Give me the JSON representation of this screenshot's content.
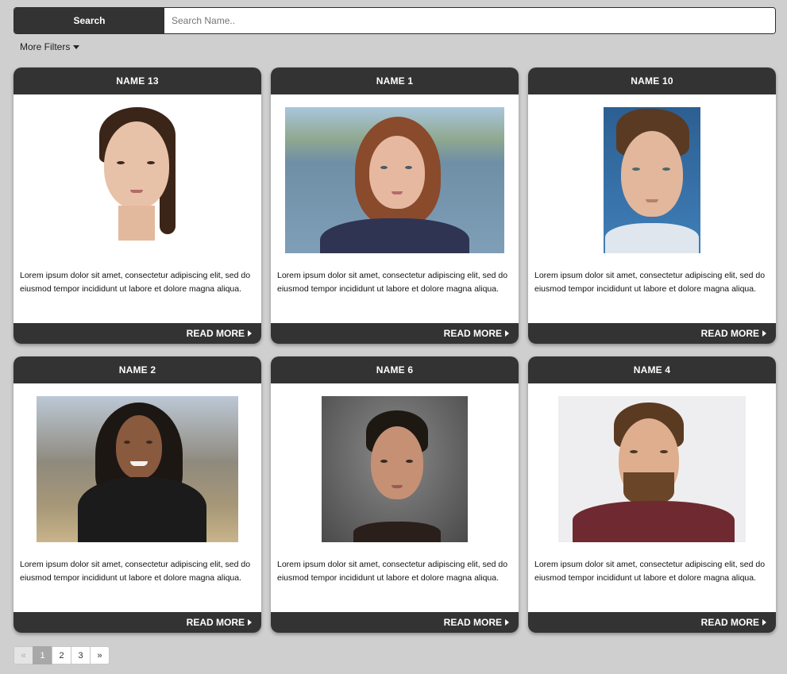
{
  "search": {
    "label": "Search",
    "placeholder": "Search Name.."
  },
  "filters": {
    "label": "More Filters"
  },
  "cards": [
    {
      "name": "NAME 13",
      "text": "Lorem ipsum dolor sit amet, consectetur adipiscing elit, sed do eiusmod tempor incididunt ut labore et dolore magna aliqua.",
      "cta": "READ MORE"
    },
    {
      "name": "NAME 1",
      "text": "Lorem ipsum dolor sit amet, consectetur adipiscing elit, sed do eiusmod tempor incididunt ut labore et dolore magna aliqua.",
      "cta": "READ MORE"
    },
    {
      "name": "NAME 10",
      "text": "Lorem ipsum dolor sit amet, consectetur adipiscing elit, sed do eiusmod tempor incididunt ut labore et dolore magna aliqua.",
      "cta": "READ MORE"
    },
    {
      "name": "NAME 2",
      "text": "Lorem ipsum dolor sit amet, consectetur adipiscing elit, sed do eiusmod tempor incididunt ut labore et dolore magna aliqua.",
      "cta": "READ MORE"
    },
    {
      "name": "NAME 6",
      "text": "Lorem ipsum dolor sit amet, consectetur adipiscing elit, sed do eiusmod tempor incididunt ut labore et dolore magna aliqua.",
      "cta": "READ MORE"
    },
    {
      "name": "NAME 4",
      "text": "Lorem ipsum dolor sit amet, consectetur adipiscing elit, sed do eiusmod tempor incididunt ut labore et dolore magna aliqua.",
      "cta": "READ MORE"
    }
  ],
  "pagination": {
    "prev": "«",
    "pages": [
      "1",
      "2",
      "3"
    ],
    "next": "»",
    "current": "1"
  },
  "colors": {
    "page_bg": "#cfcfcf",
    "dark_bar": "#333333",
    "card_bg": "#ffffff"
  }
}
